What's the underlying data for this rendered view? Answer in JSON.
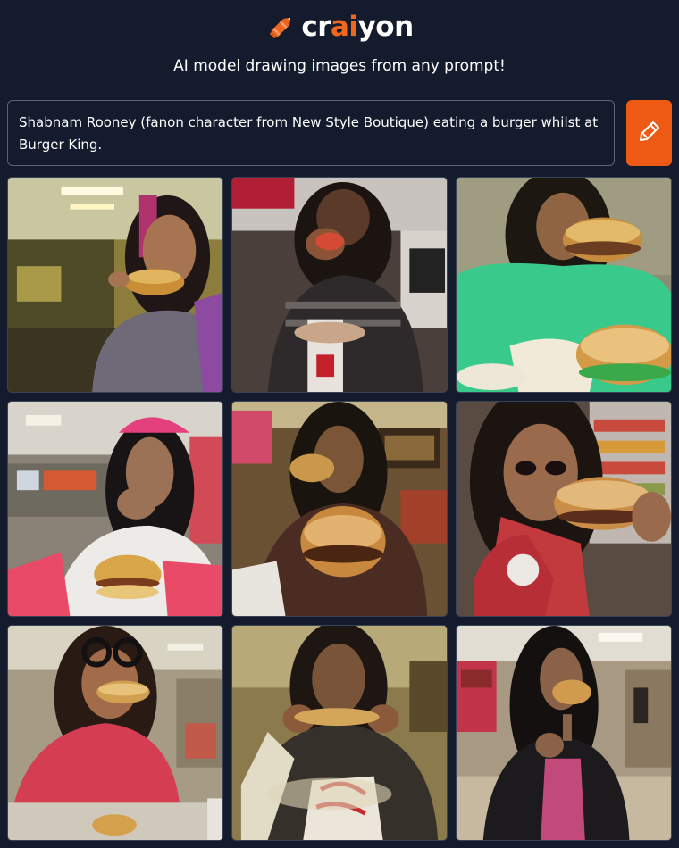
{
  "brand": {
    "name_prefix": "cr",
    "name_accent": "ai",
    "name_suffix": "yon",
    "logo_icon": "crayon-icon",
    "accent_color": "#f0671e"
  },
  "tagline": "AI model drawing images from any prompt!",
  "prompt": {
    "value": "Shabnam Rooney (fanon character from New Style Boutique) eating a burger whilst at Burger King."
  },
  "draw_button": {
    "icon": "pencil-icon",
    "color": "#ee5a13"
  },
  "results": {
    "count": 9
  }
}
